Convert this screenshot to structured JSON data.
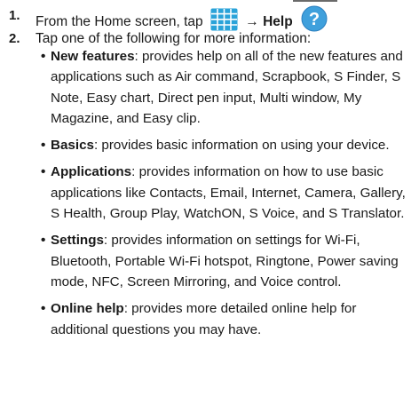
{
  "steps": [
    {
      "num": "1.",
      "text": "From the Home screen, tap",
      "arrow": "→",
      "bold": "Help"
    },
    {
      "num": "2.",
      "text": "Tap one of the following for more information:"
    }
  ],
  "icons": {
    "apps": "apps-grid-icon",
    "help": "help-question-icon"
  },
  "colors": {
    "apps_icon": "#2aa3d9",
    "help_icon": "#3fa0dc"
  },
  "bullets": [
    {
      "term": "New features",
      "desc": ": provides help on all of the new features and applications such as Air command, Scrapbook, S Finder, S Note, Easy chart, Direct pen input, Multi window, My Magazine, and Easy clip."
    },
    {
      "term": "Basics",
      "desc": ": provides basic information on using your device."
    },
    {
      "term": "Applications",
      "desc": ": provides information on how to use basic applications like Contacts, Email, Internet, Camera, Gallery, S Health, Group Play, WatchON, S Voice, and S Translator."
    },
    {
      "term": "Settings",
      "desc": ": provides information on settings for Wi-Fi, Bluetooth, Portable Wi-Fi hotspot, Ringtone, Power saving mode, NFC, Screen Mirroring, and Voice control."
    },
    {
      "term": "Online help",
      "desc": ": provides more detailed online help for additional questions you may have."
    }
  ]
}
